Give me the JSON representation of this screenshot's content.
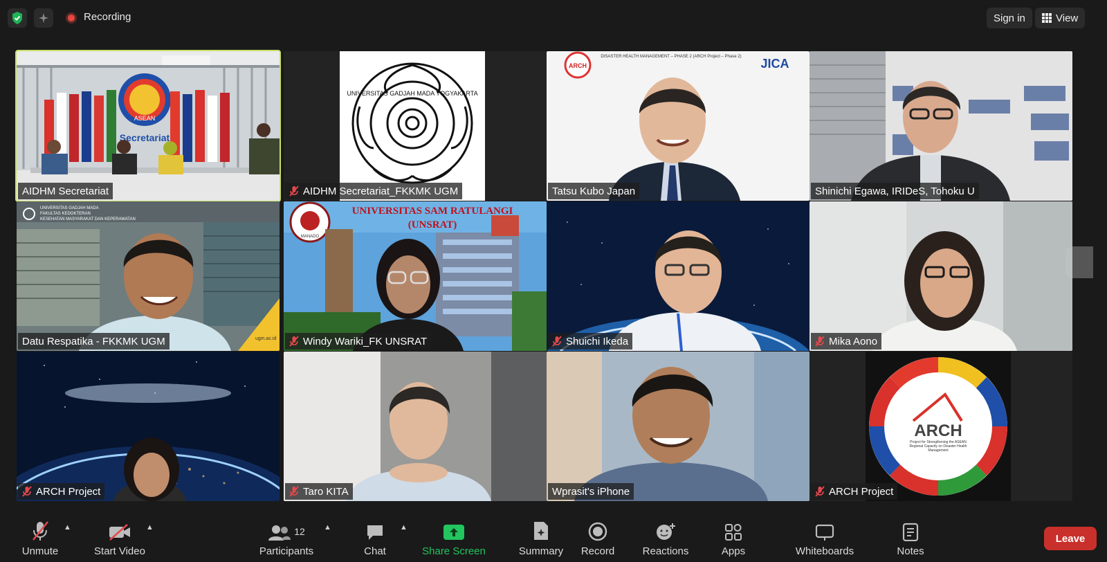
{
  "topbar": {
    "recording_label": "Recording",
    "sign_in_label": "Sign in",
    "view_label": "View"
  },
  "tiles": [
    {
      "name": "AIDHM Secretariat",
      "muted": false,
      "active": true
    },
    {
      "name": "AIDHM Secretariat_FKKMK UGM",
      "muted": true
    },
    {
      "name": "Tatsu Kubo Japan",
      "muted": false
    },
    {
      "name": "Shinichi Egawa, IRIDeS, Tohoku U",
      "muted": false
    },
    {
      "name": "Datu Respatika - FKKMK UGM",
      "muted": false
    },
    {
      "name": "Windy Wariki_FK UNSRAT",
      "muted": true
    },
    {
      "name": "Shuichi Ikeda",
      "muted": true
    },
    {
      "name": "Mika Aono",
      "muted": true
    },
    {
      "name": "ARCH Project",
      "muted": true
    },
    {
      "name": "Taro KITA",
      "muted": true
    },
    {
      "name": "Wprasit's iPhone",
      "muted": false
    },
    {
      "name": "ARCH Project",
      "muted": true
    }
  ],
  "backgrounds": {
    "asean_sign": "ASEAN",
    "secretariat_sign": "Secretariat",
    "ugm_seal": "UNIVERSITAS GADJAH MADA YOGYAKARTA",
    "ugm_header_1": "UNIVERSITAS GADJAH MADA",
    "ugm_header_2": "FAKULTAS KEDOKTERAN",
    "ugm_header_3": "KESEHATAN MASYARAKAT DAN KEPERAWATAN",
    "ugm_url": "ugm.ac.id",
    "jica_banner": "DISASTER HEALTH MANAGEMENT – PHASE 2 (ARCH Project – Phase 2)",
    "jica_logo": "JICA",
    "arch_logo_small": "ARCH",
    "unsrat_title": "UNIVERSITAS SAM RATULANGI",
    "unsrat_sub": "(UNSRAT)",
    "unsrat_seal": "MANADO",
    "arch_logo": "ARCH",
    "arch_tagline": "Project for Strengthening the ASEAN Regional Capacity on Disaster Health Management"
  },
  "toolbar": {
    "unmute": "Unmute",
    "start_video": "Start Video",
    "participants": "Participants",
    "participants_count": "12",
    "chat": "Chat",
    "share_screen": "Share Screen",
    "summary": "Summary",
    "record": "Record",
    "reactions": "Reactions",
    "apps": "Apps",
    "whiteboards": "Whiteboards",
    "notes": "Notes",
    "leave": "Leave"
  },
  "colors": {
    "active_speaker": "#c9e06a",
    "share_green": "#22c55e",
    "leave_red": "#c9302c",
    "muted_red": "#e5484d"
  }
}
